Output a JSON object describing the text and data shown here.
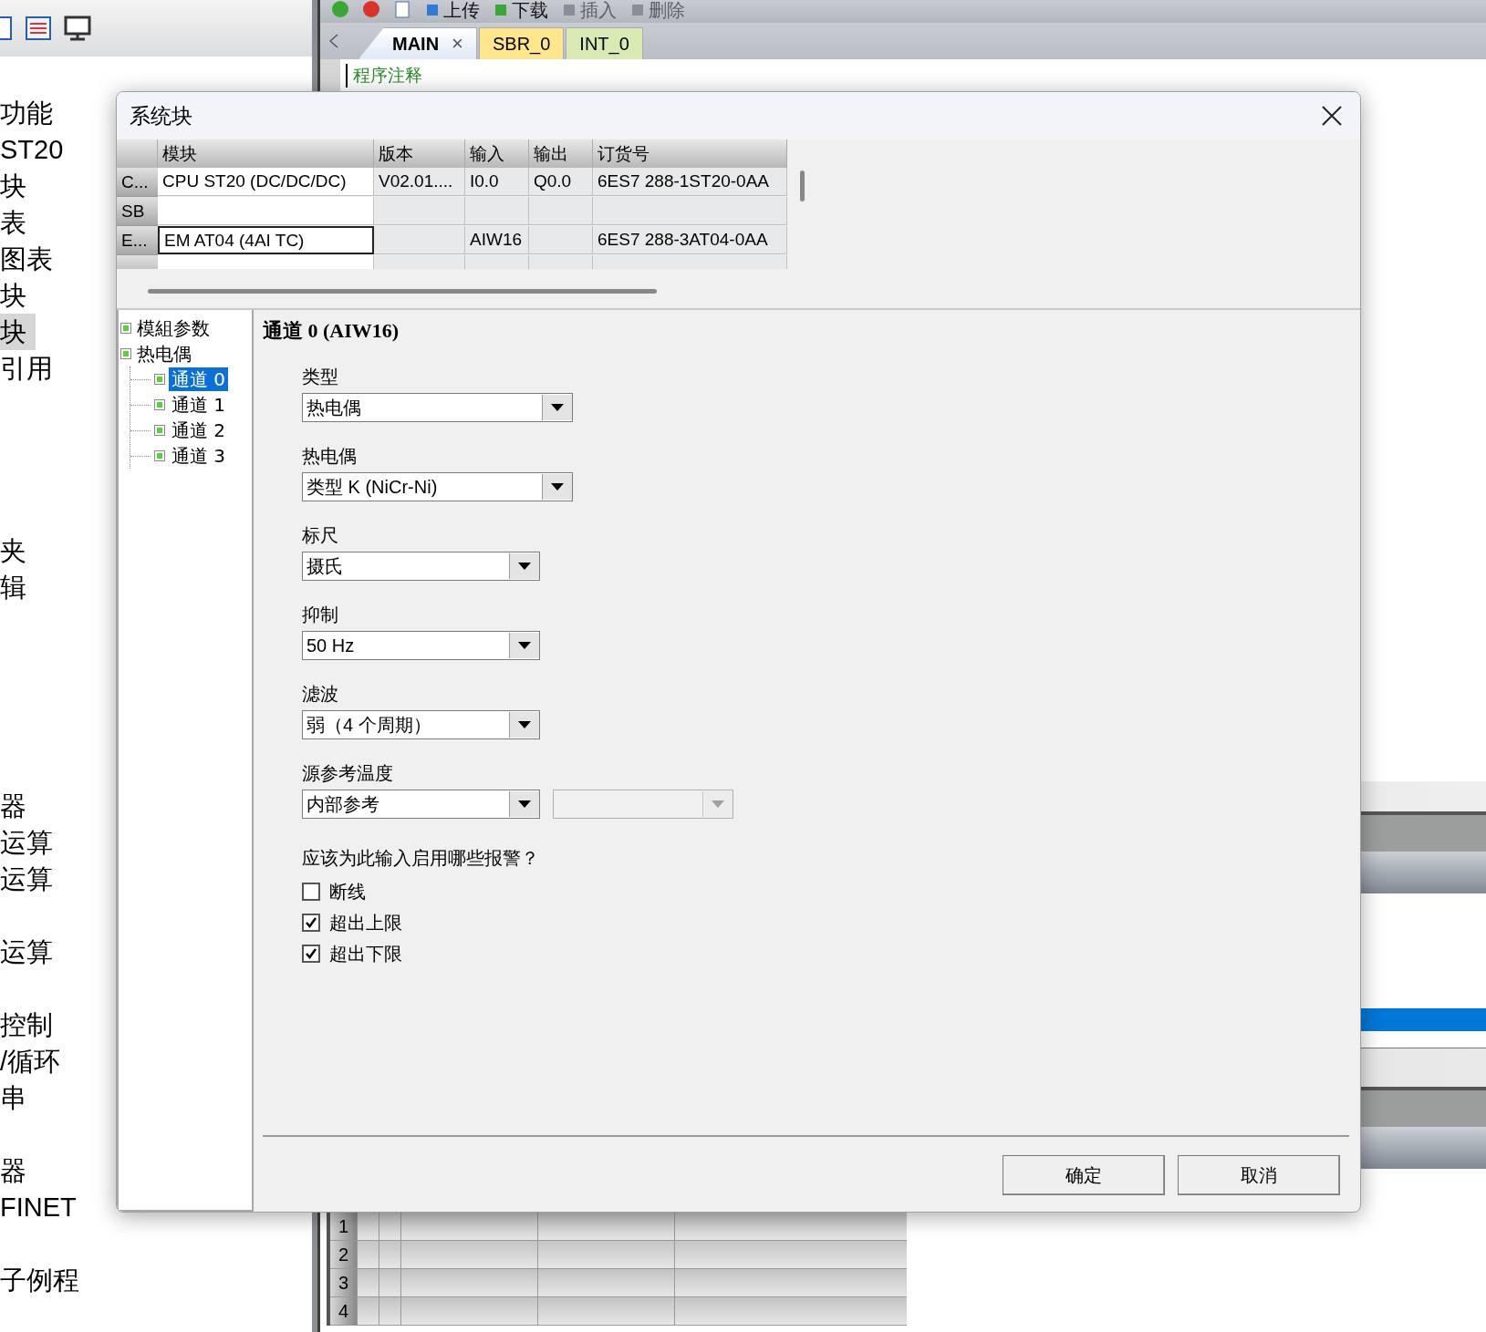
{
  "left_panel": {
    "groups": [
      [
        {
          "label": "功能",
          "highlighted": false
        },
        {
          "label": "ST20",
          "highlighted": false
        },
        {
          "label": "块",
          "highlighted": false
        },
        {
          "label": "表",
          "highlighted": false
        },
        {
          "label": "图表",
          "highlighted": false
        },
        {
          "label": "块",
          "highlighted": false
        },
        {
          "label": "块",
          "highlighted": true
        },
        {
          "label": "引用",
          "highlighted": false
        }
      ],
      [
        {
          "label": "夹",
          "highlighted": false
        },
        {
          "label": "辑",
          "highlighted": false
        }
      ],
      [
        {
          "label": "器",
          "highlighted": false
        },
        {
          "label": "运算",
          "highlighted": false
        },
        {
          "label": "运算",
          "highlighted": false
        }
      ],
      [
        {
          "label": "运算",
          "highlighted": false
        }
      ],
      [
        {
          "label": "控制",
          "highlighted": false
        },
        {
          "label": "/循环",
          "highlighted": false
        },
        {
          "label": "串",
          "highlighted": false
        }
      ],
      [
        {
          "label": "器",
          "highlighted": false
        },
        {
          "label": "FINET",
          "highlighted": false
        }
      ],
      [
        {
          "label": "子例程",
          "highlighted": false
        }
      ]
    ]
  },
  "toolbar": {
    "items": [
      {
        "label": "上传",
        "disabled": false
      },
      {
        "label": "下载",
        "disabled": false
      },
      {
        "label": "插入",
        "disabled": true
      },
      {
        "label": "删除",
        "disabled": true
      }
    ]
  },
  "editor": {
    "tabs": [
      {
        "label": "MAIN",
        "selected": true,
        "close": "×",
        "color": "#ffffff"
      },
      {
        "label": "SBR_0",
        "selected": false,
        "color": "#ffe68c"
      },
      {
        "label": "INT_0",
        "selected": false,
        "color": "#d9ebb5"
      }
    ],
    "comment": "程序注释",
    "grid_rows": [
      "1",
      "2",
      "3",
      "4"
    ]
  },
  "dialog": {
    "title": "系统块",
    "table": {
      "columns": [
        "模块",
        "版本",
        "输入",
        "输出",
        "订货号"
      ],
      "rows": [
        {
          "header": "C...",
          "cells": [
            "CPU ST20 (DC/DC/DC)",
            "V02.01....",
            "I0.0",
            "Q0.0",
            "6ES7 288-1ST20-0AA"
          ],
          "focused": false
        },
        {
          "header": "SB",
          "cells": [],
          "focused": false
        },
        {
          "header": "E...",
          "cells": [
            "EM AT04 (4AI TC)",
            null,
            "AIW16",
            null,
            "6ES7 288-3AT04-0AA"
          ],
          "focused": true
        },
        {
          "cells": [],
          "focused": false
        }
      ]
    },
    "tree": [
      {
        "label": "模組参数"
      },
      {
        "label": "热电偶",
        "children": [
          {
            "label": "通道 0",
            "selected": true
          },
          {
            "label": "通道 1",
            "selected": false
          },
          {
            "label": "通道 2",
            "selected": false
          },
          {
            "label": "通道 3",
            "selected": false
          }
        ]
      }
    ],
    "heading": "通道 0 (AIW16)",
    "fields": [
      {
        "label": "类型",
        "value": "热电偶"
      },
      {
        "label": "热电偶",
        "value": "类型 K (NiCr-Ni)"
      },
      {
        "label": "标尺",
        "value": "摄氏"
      },
      {
        "label": "抑制",
        "value": "50 Hz"
      },
      {
        "label": "滤波",
        "value": "弱（4 个周期）"
      },
      {
        "label": "源参考温度",
        "value": "内部参考",
        "secondary": {
          "disabled": true
        }
      }
    ],
    "alarms": {
      "question": "应该为此输入启用哪些报警？",
      "options": [
        {
          "label": "断线",
          "checked": false
        },
        {
          "label": "超出上限",
          "checked": true
        },
        {
          "label": "超出下限",
          "checked": true
        }
      ]
    },
    "buttons": [
      "确定",
      "取消"
    ]
  }
}
